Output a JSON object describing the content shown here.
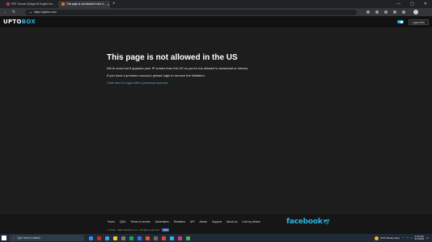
{
  "browser": {
    "tabs": [
      {
        "label": "PDF Cleaner Syllogic IB English Vis...",
        "favicon_color": "#b33a3a",
        "active": false
      },
      {
        "label": "This page is not allowed in the U...",
        "favicon_color": "#e06b2a",
        "active": true
      }
    ],
    "new_tab": "+",
    "url": "https://upbbox.com",
    "window_controls": [
      "—",
      "▢",
      "✕"
    ]
  },
  "site": {
    "logo_part1": "UPTO",
    "logo_part2": "BOX",
    "login_label": "Login/Join"
  },
  "main": {
    "title": "This page is not allowed in the US",
    "message": "We're sorry but it appears your IP comes from the US so you're not allowed to download or stream.",
    "premium_message": "If you have a premium account, please login to remove the limitation.",
    "premium_link": "Click here to login with a premium account"
  },
  "footer": {
    "links": [
      "Home",
      "Q&A",
      "Terms of service",
      "Advertisers",
      "Resellers",
      "API",
      "Abuse",
      "Support",
      "About us",
      "Link my device"
    ],
    "copyright": "© 2011 - 2023 Uptobox.com - All rights reserved",
    "fb_like": "Like",
    "brand": "facebook"
  },
  "taskbar": {
    "search_placeholder": "Type here to search",
    "weather": "54°F  Mostly clear",
    "time": "4:25 AM",
    "date": "6/7/2023",
    "app_colors": [
      "#2c8cf4",
      "#c62828",
      "#3aa0e0",
      "#f6c343",
      "#7b7b7b",
      "#1ea362",
      "#3a6ee8",
      "#e05a2a",
      "#6a6a6a",
      "#d94848",
      "#2bb3e3",
      "#c73f8a",
      "#4caf50"
    ]
  },
  "colors": {
    "accent": "#2bb3e3",
    "background": "#1d1d1d",
    "link": "#4fb6e3"
  }
}
